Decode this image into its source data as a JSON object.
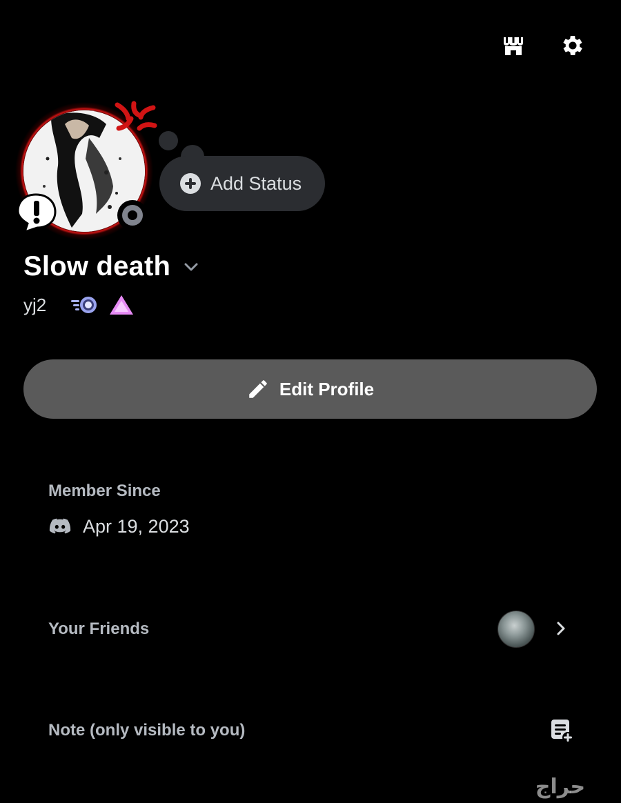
{
  "header": {
    "shop_icon": "shop-icon",
    "settings_icon": "gear-icon"
  },
  "status": {
    "add_status_label": "Add Status",
    "presence": "idle-offline"
  },
  "profile": {
    "display_name": "Slow death",
    "username": "yj2",
    "badges": [
      "nitro-badge",
      "quest-triangle-badge"
    ]
  },
  "actions": {
    "edit_profile_label": "Edit Profile"
  },
  "member_since": {
    "title": "Member Since",
    "date": "Apr 19, 2023"
  },
  "friends": {
    "title": "Your Friends"
  },
  "note": {
    "title": "Note (only visible to you)"
  },
  "colors": {
    "background": "#000000",
    "button_bg": "#5a5a5a",
    "bubble_bg": "#2b2d31",
    "section_text": "#b5bac1",
    "avatar_ring": "#d11414",
    "badge_purple": "#e78bf5"
  },
  "watermark": "حراج"
}
